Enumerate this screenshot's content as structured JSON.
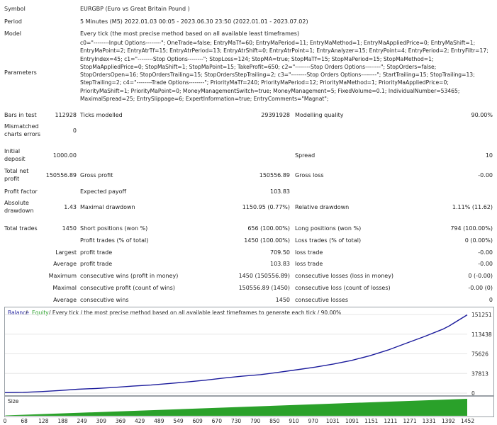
{
  "header": [
    {
      "label": "Symbol",
      "value": "EURGBP (Euro vs Great Britain Pound )"
    },
    {
      "label": "Period",
      "value": "5 Minutes (M5) 2022.01.03 00:05 - 2023.06.30 23:50 (2022.01.01 - 2023.07.02)"
    },
    {
      "label": "Model",
      "value": "Every tick (the most precise method based on all available least timeframes)"
    }
  ],
  "parameters": {
    "label": "Parameters",
    "text": "c0=\"--------Input Options--------\"; OneTrade=false; EntryMaTf=60; EntryMaPeriod=11; EntryMaMethod=1; EntryMaAppliedPrice=0; EntryMaShift=1; EntryMaPoint=2; EntryAtrTf=15; EntryAtrPeriod=13; EntryAtrShift=0; EntryAtrPoint=1; EntryAnalyzer=15; EntryPoint=4; EntryPeriod=2; EntryFiltr=17; EntryIndex=45; c1=\"--------Stop Options--------\"; StopLoss=124; StopMA=true; StopMaTf=15; StopMaPeriod=15; StopMaMethod=1; StopMaAppliedPrice=0; StopMaShift=1; StopMaPoint=15; TakeProfit=650; c2=\"--------Stop Orders Options--------\"; StopOrders=false; StopOrdersOpen=16; StopOrdersTrailing=15; StopOrdersStepTrailing=2; c3=\"--------Stop Orders Options--------\"; StartTrailing=15; StopTrailing=13; StepTrailing=2; c4=\"--------Trade Options--------\"; PriorityMaTf=240; PriorityMaPeriod=12; PriorityMaMethod=1; PriorityMaAppliedPrice=0; PriorityMaShift=1; PriorityMaPoint=0; MoneyManagementSwitch=true; MoneyManagement=5; FixedVolume=0.1; IndividualNumber=53465; MaximalSpread=25; EntrySlippage=6; ExpertInformation=true; EntryComments=\"Magnat\";"
  },
  "stats": {
    "bars_label": "Bars in test",
    "bars": "112928",
    "ticks_label": "Ticks modelled",
    "ticks": "29391928",
    "quality_label": "Modelling quality",
    "quality": "90.00%",
    "mismatched_label": "Mismatched charts errors",
    "mismatched": "0",
    "initial_label": "Initial deposit",
    "initial": "1000.00",
    "spread_label": "Spread",
    "spread": "10",
    "netprofit_label": "Total net profit",
    "netprofit": "150556.89",
    "grossprofit_label": "Gross profit",
    "grossprofit": "150556.89",
    "grossloss_label": "Gross loss",
    "grossloss": "-0.00",
    "pf_label": "Profit factor",
    "payoff_label": "Expected payoff",
    "payoff": "103.83",
    "absdd_label": "Absolute drawdown",
    "absdd": "1.43",
    "maxdd_label": "Maximal drawdown",
    "maxdd": "1150.95 (0.77%)",
    "reldd_label": "Relative drawdown",
    "reldd": "1.11% (11.62)",
    "trades_label": "Total trades",
    "trades": "1450",
    "short_label": "Short positions (won %)",
    "short": "656 (100.00%)",
    "long_label": "Long positions (won %)",
    "long": "794 (100.00%)",
    "profittrades_label": "Profit trades (% of total)",
    "profittrades": "1450 (100.00%)",
    "losstrades_label": "Loss trades (% of total)",
    "losstrades": "0 (0.00%)",
    "largest_label": "Largest",
    "lp_label": "profit trade",
    "lp": "709.50",
    "ll_label": "loss trade",
    "ll": "-0.00",
    "average_label": "Average",
    "ap_label": "profit trade",
    "ap": "103.83",
    "al_label": "loss trade",
    "al": "-0.00",
    "maximum_label": "Maximum",
    "mcw_label": "consecutive wins (profit in money)",
    "mcw": "1450 (150556.89)",
    "mcl_label": "consecutive losses (loss in money)",
    "mcl": "0 (-0.00)",
    "maximal_label": "Maximal",
    "mcp_label": "consecutive profit (count of wins)",
    "mcp": "150556.89 (1450)",
    "mclc_label": "consecutive loss (count of losses)",
    "mclc": "-0.00 (0)",
    "avg2_label": "Average",
    "acw_label": "consecutive wins",
    "acw": "1450",
    "acl_label": "consecutive losses",
    "acl": "0"
  },
  "chart_legend": {
    "balance": "Balance",
    "sep": " / ",
    "equity": "Equity",
    "rest": " / Every tick / the most precise method based on all available least timeframes to generate each tick / 90.00%"
  },
  "size_label": "Size",
  "colors": {
    "balance": "#1c1c9c",
    "equity": "#2aa12a",
    "size": "#2aa12a",
    "grid": "#e6e6e6"
  },
  "chart_data": {
    "type": "line",
    "xlabel": "",
    "ylabel": "",
    "x_ticks": [
      "0",
      "68",
      "128",
      "188",
      "249",
      "309",
      "369",
      "429",
      "489",
      "549",
      "609",
      "670",
      "730",
      "790",
      "850",
      "910",
      "970",
      "1031",
      "1091",
      "1151",
      "1211",
      "1271",
      "1331",
      "1392",
      "1452"
    ],
    "y_ticks": [
      "0",
      "37813",
      "75626",
      "113438",
      "151251"
    ],
    "ylim": [
      0,
      151251
    ],
    "xlim": [
      0,
      1520
    ],
    "series": [
      {
        "name": "Balance",
        "x": [
          0,
          60,
          120,
          180,
          240,
          300,
          360,
          420,
          480,
          540,
          600,
          660,
          720,
          780,
          840,
          900,
          960,
          1020,
          1080,
          1140,
          1200,
          1260,
          1320,
          1380,
          1440,
          1460,
          1520
        ],
        "values": [
          1000,
          1500,
          3000,
          5000,
          7500,
          9000,
          11000,
          13500,
          15500,
          18500,
          21500,
          25000,
          29000,
          32500,
          35500,
          40000,
          45000,
          50000,
          56000,
          63000,
          72000,
          83000,
          96000,
          109000,
          123000,
          129000,
          150557
        ]
      }
    ],
    "size_area": {
      "x": [
        1,
        1520
      ],
      "values": [
        0.1,
        5
      ],
      "label": "Size"
    }
  }
}
